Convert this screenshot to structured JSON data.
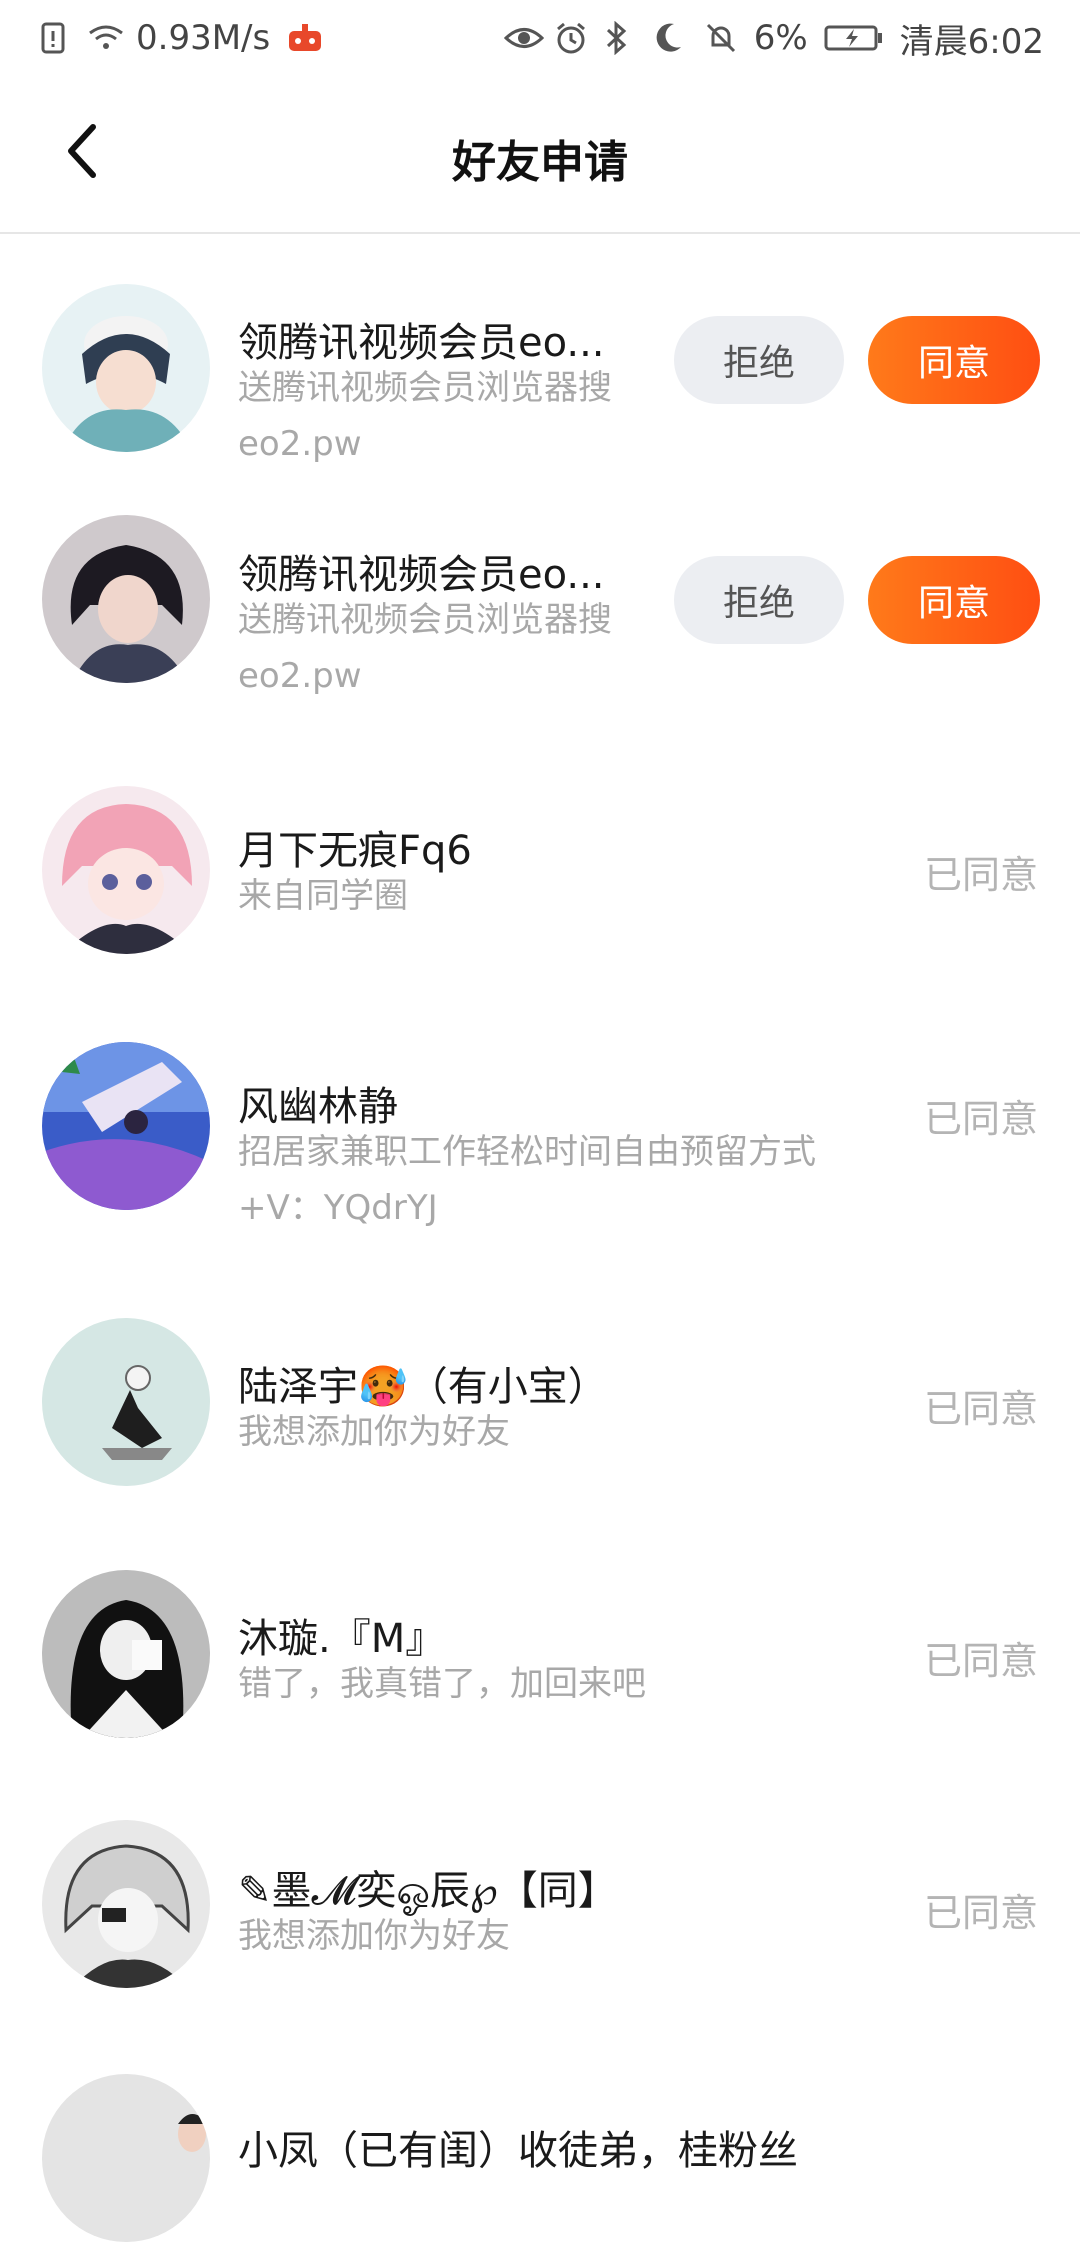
{
  "status_bar": {
    "speed": "0.93M/s",
    "battery": "6%",
    "time": "清晨6:02"
  },
  "nav": {
    "title": "好友申请"
  },
  "buttons": {
    "reject": "拒绝",
    "accept": "同意"
  },
  "items": [
    {
      "name": "领腾讯视频会员eo...",
      "msg1": "送腾讯视频会员浏览器搜",
      "msg2": "eo2.pw",
      "status": ""
    },
    {
      "name": "领腾讯视频会员eo...",
      "msg1": "送腾讯视频会员浏览器搜",
      "msg2": "eo2.pw",
      "status": ""
    },
    {
      "name": "月下无痕Fq6",
      "msg1": "来自同学圈",
      "msg2": "",
      "status": "已同意"
    },
    {
      "name": "风幽林静",
      "msg1": "招居家兼职工作轻松时间自由预留方式",
      "msg2": "+V：YQdrYJ",
      "status": "已同意"
    },
    {
      "name": "陆泽宇🥵（有小宝）",
      "msg1": "我想添加你为好友",
      "msg2": "",
      "status": "已同意"
    },
    {
      "name": "沐璇.『M』",
      "msg1": "错了，我真错了，加回来吧",
      "msg2": "",
      "status": "已同意"
    },
    {
      "name": "✎墨𝓜奕ஓ辰℘【同】",
      "msg1": "我想添加你为好友",
      "msg2": "",
      "status": "已同意"
    },
    {
      "name": "小凤（已有闺）收徒弟，桂粉丝",
      "msg1": "",
      "msg2": "",
      "status": ""
    }
  ],
  "colors": {
    "accent": "#ff5a14",
    "reject_bg": "#eceef2",
    "muted_text": "#a8a8a8"
  }
}
